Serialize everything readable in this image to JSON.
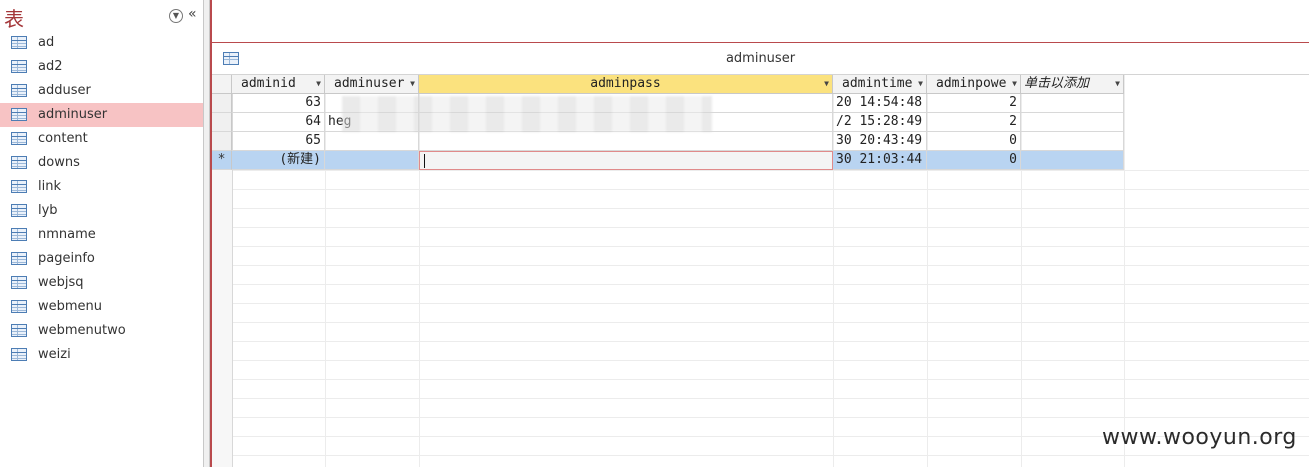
{
  "nav": {
    "title": "表",
    "dropdown_icon": "chevron-down-circle-icon",
    "collapse_icon": "double-chevron-left-icon",
    "items": [
      {
        "label": "ad",
        "selected": false
      },
      {
        "label": "ad2",
        "selected": false
      },
      {
        "label": "adduser",
        "selected": false
      },
      {
        "label": "adminuser",
        "selected": true
      },
      {
        "label": "content",
        "selected": false
      },
      {
        "label": "downs",
        "selected": false
      },
      {
        "label": "link",
        "selected": false
      },
      {
        "label": "lyb",
        "selected": false
      },
      {
        "label": "nmname",
        "selected": false
      },
      {
        "label": "pageinfo",
        "selected": false
      },
      {
        "label": "webjsq",
        "selected": false
      },
      {
        "label": "webmenu",
        "selected": false
      },
      {
        "label": "webmenutwo",
        "selected": false
      },
      {
        "label": "weizi",
        "selected": false
      }
    ]
  },
  "document": {
    "tab_title": "adminuser"
  },
  "table": {
    "columns": [
      {
        "label": "adminid"
      },
      {
        "label": "adminuser"
      },
      {
        "label": "adminpass"
      },
      {
        "label": "admintime"
      },
      {
        "label": "adminpowe"
      },
      {
        "label": "单击以添加"
      }
    ],
    "rows": [
      {
        "adminid": "63",
        "adminuser": "",
        "adminpass": "",
        "admintime": "20 14:54:48",
        "adminpower": "2"
      },
      {
        "adminid": "64",
        "adminuser": "heg",
        "adminpass": "",
        "admintime": "/2 15:28:49",
        "adminpower": "2"
      },
      {
        "adminid": "65",
        "adminuser": "",
        "adminpass": "",
        "admintime": "30 20:43:49",
        "adminpower": "0"
      }
    ],
    "new_row": {
      "marker": "*",
      "adminid": "(新建)",
      "admintime": "30 21:03:44",
      "adminpower": "0"
    }
  },
  "watermark": "www.wooyun.org",
  "colors": {
    "accent": "#b94a4d",
    "selected_nav": "#f7c3c4",
    "active_header": "#fbe27e",
    "new_row": "#b9d4f1"
  }
}
